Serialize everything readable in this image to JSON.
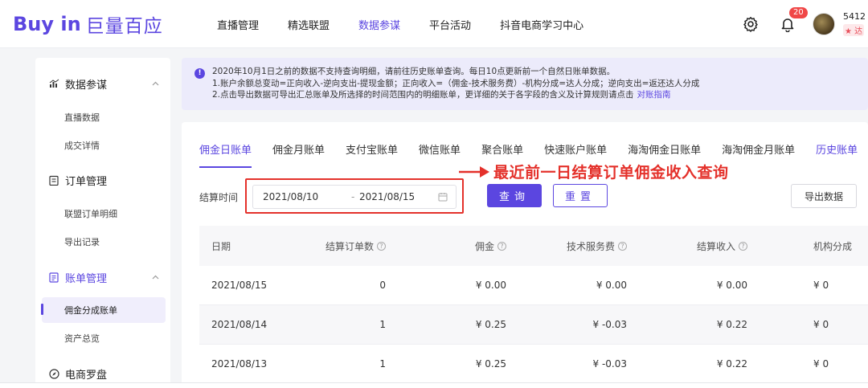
{
  "brand": {
    "logo_en": "Buy in",
    "logo_cn": "巨量百应"
  },
  "nav": {
    "items": [
      "直播管理",
      "精选联盟",
      "数据参谋",
      "平台活动",
      "抖音电商学习中心"
    ],
    "active_index": 2
  },
  "header": {
    "notification_count": "20",
    "user_id": "5412",
    "user_tag": "★ 达"
  },
  "sidebar": {
    "groups": [
      {
        "label": "数据参谋",
        "icon": "chart-icon",
        "items": [
          "直播数据",
          "成交详情"
        ]
      },
      {
        "label": "订单管理",
        "icon": "clipboard-icon",
        "items": [
          "联盟订单明细",
          "导出记录"
        ]
      },
      {
        "label": "账单管理",
        "icon": "bill-icon",
        "items": [
          "佣金分成账单",
          "资产总览"
        ]
      },
      {
        "label": "电商罗盘",
        "icon": "compass-icon",
        "items": []
      }
    ],
    "active_item": "佣金分成账单"
  },
  "notice": {
    "line1": "2020年10月1日之前的数据不支持查询明细，请前往历史账单查询。每日10点更新前一个自然日账单数据。",
    "line2": "1.账户余额总变动=正向收入-逆向支出-提现金额；正向收入=（佣金-技术服务费）-机构分成=达人分成；逆向支出=返还达人分成",
    "line3": "2.点击导出数据可导出汇总账单及所选择的时间范围内的明细账单，更详细的关于各字段的含义及计算规则请点击",
    "link": "对账指南"
  },
  "tabs": [
    "佣金日账单",
    "佣金月账单",
    "支付宝账单",
    "微信账单",
    "聚合账单",
    "快速账户账单",
    "海淘佣金日账单",
    "海淘佣金月账单",
    "历史账单"
  ],
  "filter": {
    "label": "结算时间",
    "start": "2021/08/10",
    "separator": "-",
    "end": "2021/08/15"
  },
  "buttons": {
    "query": "查询",
    "reset": "重置",
    "export": "导出数据"
  },
  "annotation": {
    "text": "最近前一日结算订单佣金收入查询",
    "color": "#e4312b"
  },
  "table": {
    "columns": [
      "日期",
      "结算订单数",
      "佣金",
      "技术服务费",
      "结算收入",
      "机构分成"
    ],
    "rows": [
      [
        "2021/08/15",
        "0",
        "¥ 0.00",
        "¥ 0.00",
        "¥ 0.00",
        "¥ 0"
      ],
      [
        "2021/08/14",
        "1",
        "¥ 0.25",
        "¥ -0.03",
        "¥ 0.22",
        "¥ 0"
      ],
      [
        "2021/08/13",
        "1",
        "¥ 0.25",
        "¥ -0.03",
        "¥ 0.22",
        "¥ 0"
      ]
    ]
  },
  "colors": {
    "accent": "#5b46e0",
    "notice_bg": "#ecebfb",
    "badge": "#f04747",
    "annotation": "#e4312b"
  }
}
